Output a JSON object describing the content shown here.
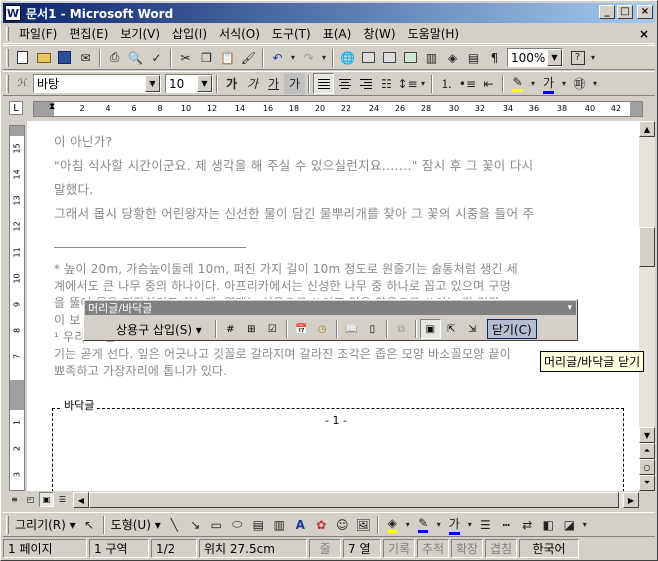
{
  "window": {
    "app_icon": "W",
    "title": "문서1 - Microsoft Word",
    "minimize": "_",
    "maximize": "□",
    "close": "×"
  },
  "menubar": {
    "items": [
      "파일(F)",
      "편집(E)",
      "보기(V)",
      "삽입(I)",
      "서식(O)",
      "도구(T)",
      "표(A)",
      "창(W)",
      "도움말(H)"
    ],
    "close": "×"
  },
  "standard_toolbar": {
    "zoom": "100%",
    "help": "?"
  },
  "formatting_toolbar": {
    "style": "",
    "font": "바탕",
    "size": "10",
    "bold": "가",
    "italic": "가",
    "underline": "가",
    "char_shade": "가",
    "font_color": "가"
  },
  "ruler": {
    "corner": "L",
    "ticks": [
      "2",
      "4",
      "6",
      "8",
      "10",
      "12",
      "14",
      "16",
      "18",
      "20",
      "22",
      "24",
      "26",
      "28",
      "30",
      "32",
      "34",
      "36",
      "38",
      "40",
      "42"
    ],
    "vticks": [
      "1",
      "2",
      "3",
      "4",
      "5",
      "6",
      "7",
      "8",
      "9",
      "10",
      "11",
      "12",
      "13",
      "14",
      "15"
    ]
  },
  "document": {
    "lines": [
      "이 아닌가?",
      "\"아침 식사할 시간이군요. 제 생각을 해 주실 수 있으실런지요.......\" 잠시 후 그 꽃이 다시",
      "말했다.",
      "그래서 몹시 당황한 어린왕자는 신선한 물이 담긴 물뿌리개를 찾아 그 꽃의 시중을 들어 주"
    ],
    "footnotes": [
      "* 높이 20m, 가슴높이둘레 10m, 퍼진 가지 길이 10m 정도로 원줄기는 술통처럼 생긴 세",
      "계에서도 큰 나무 중의 하나이다. 아프리카에서는 신성한 나무 중 하나로 꼽고 있으며 구멍",
      "을 뚫어 물을 저장하기도 하는데, 열매는 식용으로 쓰이고 잎은 약용으로 쓰이는 것                     것같",
      "이 보",
      "¹ 우리                                                                                                          고 줄",
      "기는 곧게 선다. 잎은 어긋나고 깃꼴로 갈라지며 갈라진 조각은 좁은 모양 바소꼴모양 끝이",
      "뾰족하고 가장자리에 톱니가 있다."
    ],
    "footer_label": "바닥글",
    "page_number": "- 1 -"
  },
  "hf_toolbar": {
    "title": "머리글/바닥글",
    "close_x": "▾",
    "insert_autotext": "상용구 삽입(S) ▾",
    "close_button": "닫기(C)"
  },
  "tooltip": "머리글/바닥글 닫기",
  "drawing_toolbar": {
    "draw": "그리기(R) ▾",
    "autoshapes": "도형(U) ▾",
    "font_color": "가"
  },
  "statusbar": {
    "page": "1 페이지",
    "section": "1 구역",
    "pages": "1/2",
    "at": "위치 27.5cm",
    "ln": "줄",
    "col": "7 열",
    "rec": "기록",
    "trk": "추적",
    "ext": "확장",
    "ovr": "겹침",
    "lang": "한국어"
  }
}
